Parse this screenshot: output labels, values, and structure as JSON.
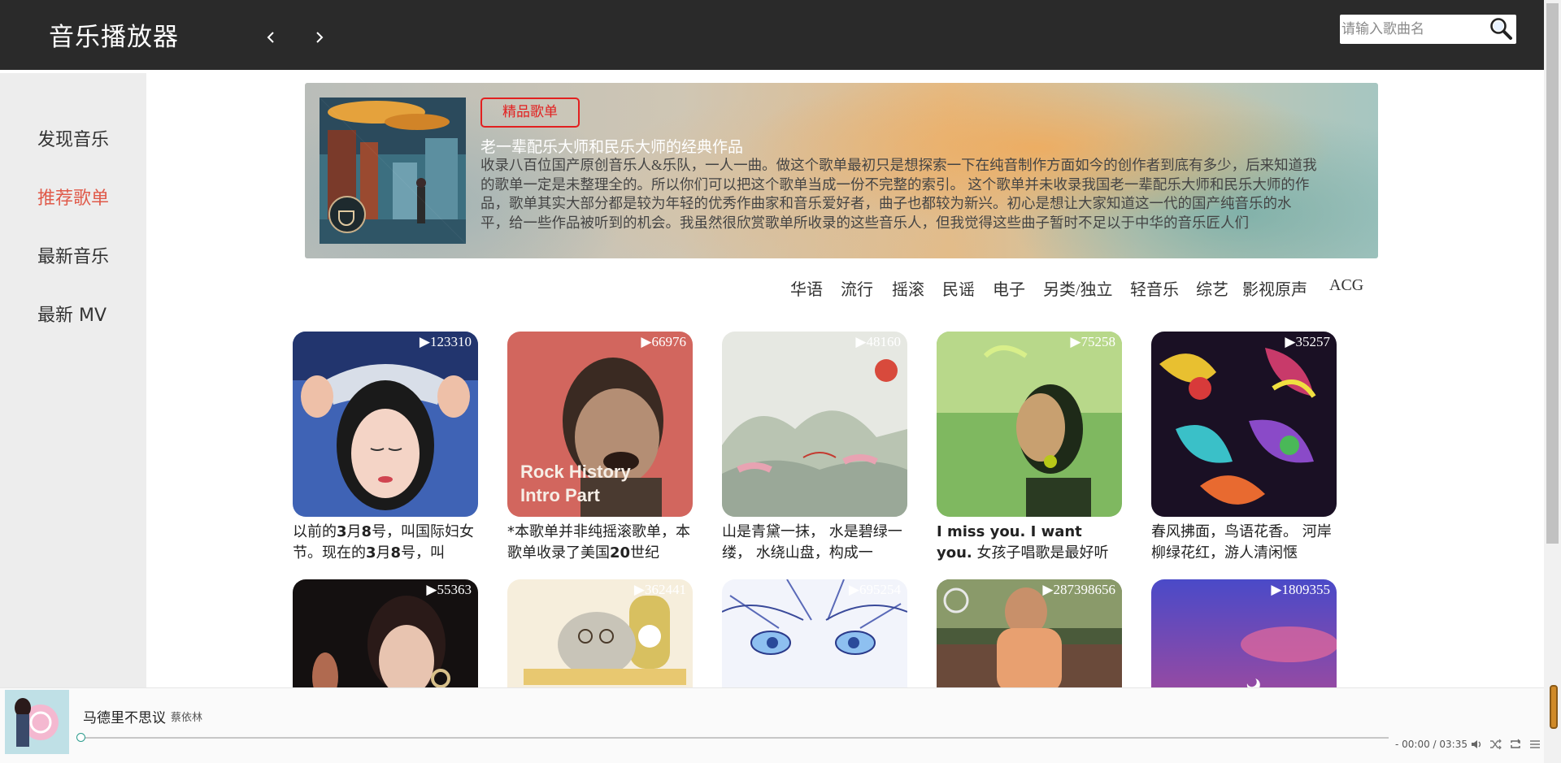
{
  "header": {
    "title": "音乐播放器",
    "search_placeholder": "请输入歌曲名",
    "icons": {
      "back": "chevron-left-icon",
      "forward": "chevron-right-icon",
      "search": "magnifier-icon"
    }
  },
  "sidebar": {
    "items": [
      {
        "label": "发现音乐",
        "active": false
      },
      {
        "label": "推荐歌单",
        "active": true
      },
      {
        "label": "最新音乐",
        "active": false
      },
      {
        "label": "最新 MV",
        "active": false
      }
    ],
    "active_color": "#e05a4a"
  },
  "banner": {
    "tag": "精品歌单",
    "title": "老一辈配乐大师和民乐大师的经典作品",
    "description": "收录八百位国产原创音乐人&乐队，一人一曲。做这个歌单最初只是想探索一下在纯音制作方面如今的创作者到底有多少，后来知道我的歌单一定是未整理全的。所以你们可以把这个歌单当成一份不完整的索引。 这个歌单并未收录我国老一辈配乐大师和民乐大师的作品，歌单其实大部分都是较为年轻的优秀作曲家和音乐爱好者，曲子也都较为新兴。初心是想让大家知道这一代的国产纯音乐的水平，给一些作品被听到的机会。我虽然很欣赏歌单所收录的这些音乐人，但我觉得这些曲子暂时不足以于中华的音乐匠人们"
  },
  "categories": [
    "华语",
    "流行",
    "摇滚",
    "民谣",
    "电子",
    "另类/独立",
    "轻音乐",
    "综艺",
    "影视原声",
    "ACG"
  ],
  "playlists": [
    {
      "count": "▶123310",
      "desc_parts": [
        "以前的",
        "3",
        "月",
        "8",
        "号，叫国际妇女节。现在的",
        "3",
        "月",
        "8",
        "号，叫"
      ],
      "cover_text": ""
    },
    {
      "count": "▶66976",
      "desc_parts": [
        "*本歌单并非纯摇滚歌单，本歌单收录了美国",
        "20",
        "世纪"
      ],
      "cover_text": "Rock History Intro Part"
    },
    {
      "count": "▶48160",
      "desc_parts": [
        "山是青黛一抹， 水是碧绿一缕， 水绕山盘，构成一"
      ],
      "cover_text": ""
    },
    {
      "count": "▶75258",
      "desc_parts": [
        "I miss you. I want you.",
        " 女孩子唱歌是最好听"
      ],
      "cover_text": ""
    },
    {
      "count": "▶35257",
      "desc_parts": [
        "春风拂面，鸟语花香。 河岸柳绿花红，游人清闲惬"
      ],
      "cover_text": ""
    },
    {
      "count": "▶55363",
      "desc_parts": [
        ""
      ],
      "cover_text": ""
    },
    {
      "count": "▶362441",
      "desc_parts": [
        ""
      ],
      "cover_text": ""
    },
    {
      "count": "▶695254",
      "desc_parts": [
        ""
      ],
      "cover_text": ""
    },
    {
      "count": "▶287398656",
      "desc_parts": [
        ""
      ],
      "cover_text": ""
    },
    {
      "count": "▶1809355",
      "desc_parts": [
        ""
      ],
      "cover_text": ""
    }
  ],
  "player": {
    "song": "马德里不思议",
    "artist": "蔡依林",
    "time": "- 00:00 / 03:35",
    "progress": 0,
    "icons": [
      "volume-icon",
      "shuffle-icon",
      "repeat-icon",
      "playlist-icon"
    ]
  }
}
